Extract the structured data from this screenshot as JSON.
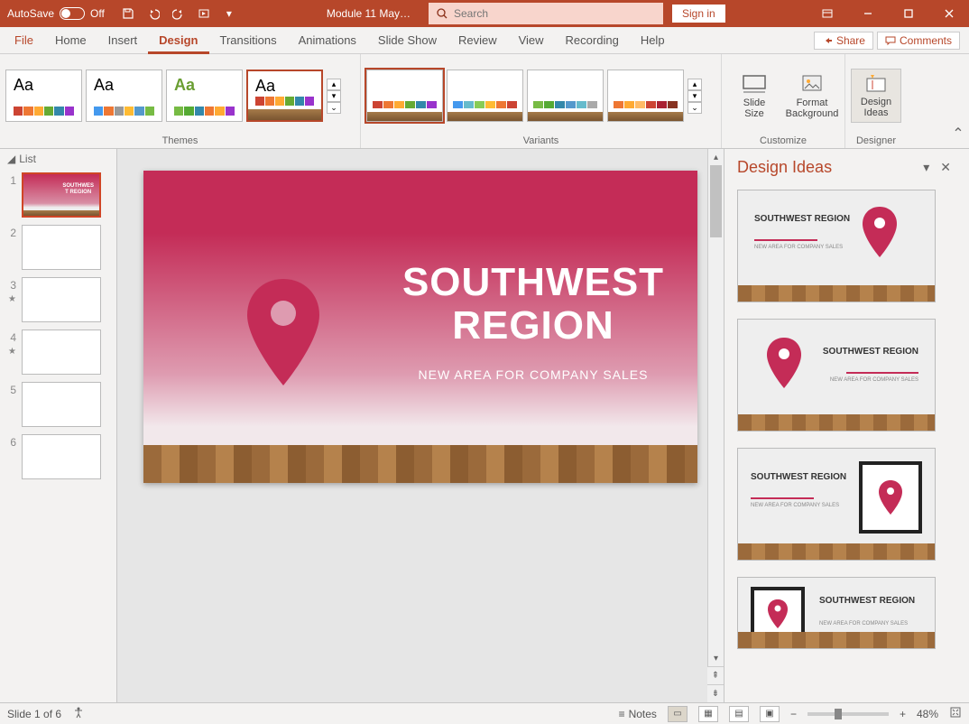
{
  "titlebar": {
    "autosave_label": "AutoSave",
    "autosave_state": "Off",
    "document_title": "Module 11 May…",
    "search_placeholder": "Search",
    "signin_label": "Sign in"
  },
  "tabs": {
    "file": "File",
    "home": "Home",
    "insert": "Insert",
    "design": "Design",
    "transitions": "Transitions",
    "animations": "Animations",
    "slideshow": "Slide Show",
    "review": "Review",
    "view": "View",
    "recording": "Recording",
    "help": "Help",
    "share": "Share",
    "comments": "Comments"
  },
  "ribbon": {
    "themes_label": "Themes",
    "variants_label": "Variants",
    "customize_label": "Customize",
    "designer_label": "Designer",
    "slide_size": "Slide\nSize",
    "format_bg": "Format\nBackground",
    "design_ideas": "Design\nIdeas"
  },
  "slidelist": {
    "header": "List",
    "items": [
      {
        "num": "1",
        "star": false
      },
      {
        "num": "2",
        "star": false
      },
      {
        "num": "3",
        "star": true
      },
      {
        "num": "4",
        "star": true
      },
      {
        "num": "5",
        "star": false
      },
      {
        "num": "6",
        "star": false
      }
    ]
  },
  "slide": {
    "title": "SOUTHWEST REGION",
    "subtitle": "NEW AREA FOR COMPANY SALES"
  },
  "design_pane": {
    "title": "Design Ideas",
    "idea_title": "SOUTHWEST REGION",
    "idea_sub": "NEW AREA FOR COMPANY SALES"
  },
  "statusbar": {
    "slide_counter": "Slide 1 of 6",
    "notes_label": "Notes",
    "zoom_percent": "48%"
  }
}
